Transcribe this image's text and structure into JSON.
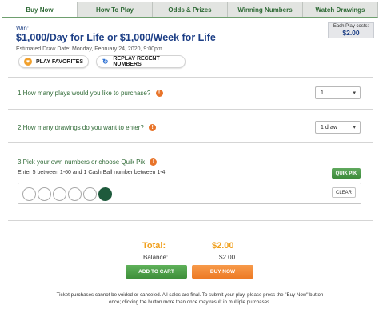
{
  "tabs": [
    {
      "label": "Buy Now",
      "active": true
    },
    {
      "label": "How To Play",
      "active": false
    },
    {
      "label": "Odds & Prizes",
      "active": false
    },
    {
      "label": "Winning Numbers",
      "active": false
    },
    {
      "label": "Watch Drawings",
      "active": false
    }
  ],
  "header": {
    "win_label": "Win:",
    "game_title": "$1,000/Day for Life or $1,000/Week for Life",
    "draw_date": "Estimated Draw Date: Monday, February 24, 2020, 9:00pm",
    "cost_label": "Each Play costs:",
    "cost_value": "$2.00"
  },
  "actions": {
    "play_favorites": "PLAY FAVORITES",
    "replay_recent": "REPLAY RECENT NUMBERS"
  },
  "questions": {
    "q1": "1  How many plays would you like to purchase?",
    "q1_value": "1",
    "q2": "2 How many drawings do you want to enter?",
    "q2_value": "1 draw",
    "q3": "3 Pick your own numbers or choose Quik Pik",
    "q3_sub": "Enter 5 between 1-60 and 1 Cash Ball number between 1-4"
  },
  "picker": {
    "quik_pik": "QUIK PIK",
    "clear": "CLEAR"
  },
  "summary": {
    "total_label": "Total:",
    "total_value": "$2.00",
    "balance_label": "Balance:",
    "balance_value": "$2.00",
    "add_to_cart": "ADD TO CART",
    "buy_now": "BUY NOW"
  },
  "disclaimer": "Ticket purchases cannot be voided or canceled. All sales are final. To submit your play, please press the \"Buy Now\" button once; clicking the button more than once may result in multiple purchases.",
  "colors": {
    "tab_text": "#2f6a36",
    "title": "#1d3f86",
    "total": "#f0a01e",
    "info_icon": "#e8742a",
    "cash_ball": "#1e5a3c"
  }
}
